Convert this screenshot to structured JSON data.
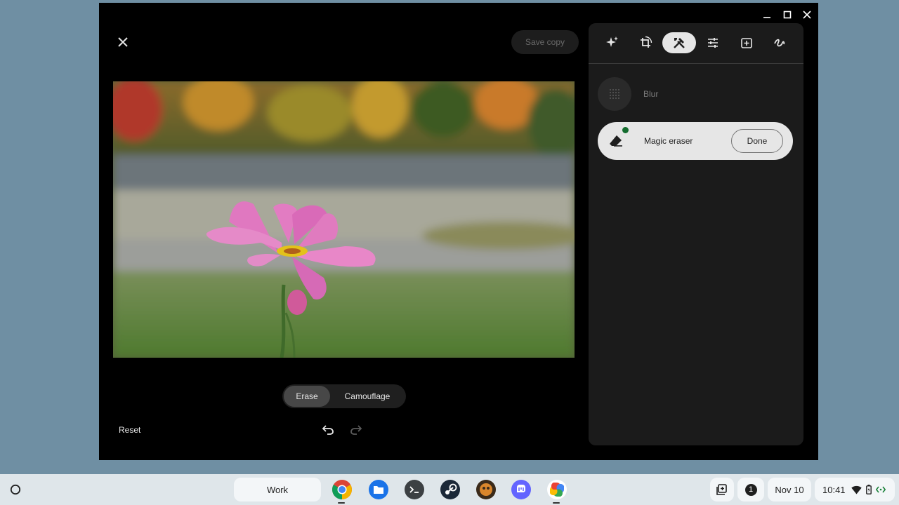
{
  "editor": {
    "save_copy_label": "Save copy",
    "modes": {
      "erase": "Erase",
      "camouflage": "Camouflage"
    },
    "reset_label": "Reset"
  },
  "panel": {
    "tabs": [
      "suggestions-icon",
      "crop-rotate-icon",
      "tools-icon",
      "adjust-icon",
      "filters-icon",
      "markup-icon"
    ],
    "active_tab": "tools-icon",
    "tools": {
      "blur_label": "Blur",
      "magic_eraser_label": "Magic eraser",
      "done_label": "Done"
    }
  },
  "shelf": {
    "desk_label": "Work",
    "apps": [
      "chrome-icon",
      "files-icon",
      "terminal-icon",
      "steam-icon",
      "app-icon",
      "mastodon-icon",
      "photos-icon"
    ],
    "notification_count": "1",
    "date": "Nov 10",
    "time": "10:41"
  },
  "colors": {
    "panel_bg": "#1b1b1b",
    "accent_green": "#146c2e",
    "shelf_bg": "#dfe6ea"
  }
}
